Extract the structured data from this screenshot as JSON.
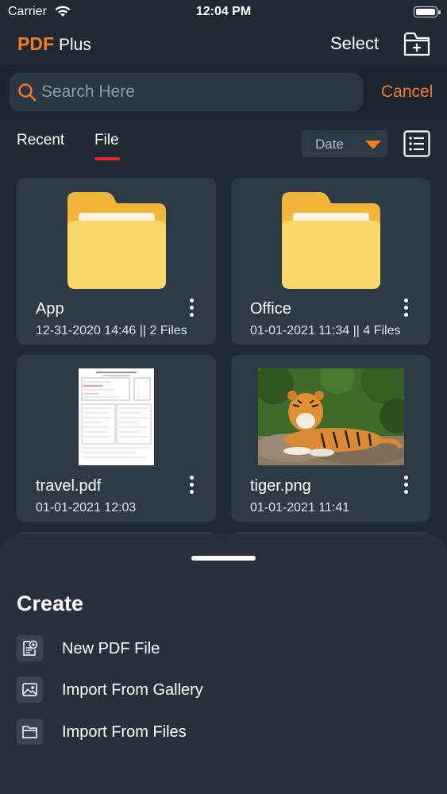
{
  "status_bar": {
    "carrier": "Carrier",
    "time": "12:04 PM"
  },
  "header": {
    "logo_pdf": "PDF",
    "logo_plus": "Plus",
    "select_label": "Select"
  },
  "search": {
    "placeholder": "Search Here",
    "value": "",
    "cancel_label": "Cancel"
  },
  "tabs": [
    {
      "label": "Recent",
      "active": false
    },
    {
      "label": "File",
      "active": true
    }
  ],
  "sort": {
    "selected": "Date"
  },
  "files": [
    {
      "name": "App",
      "meta": "12-31-2020 14:46 || 2 Files",
      "kind": "folder"
    },
    {
      "name": "Office",
      "meta": "01-01-2021 11:34 || 4 Files",
      "kind": "folder"
    },
    {
      "name": "travel.pdf",
      "meta": "01-01-2021 12:03",
      "kind": "pdf"
    },
    {
      "name": "tiger.png",
      "meta": "01-01-2021 11:41",
      "kind": "image"
    }
  ],
  "create_sheet": {
    "title": "Create",
    "items": [
      {
        "label": "New PDF File",
        "icon": "new-pdf-icon"
      },
      {
        "label": "Import From Gallery",
        "icon": "gallery-icon"
      },
      {
        "label": "Import From Files",
        "icon": "folder-icon"
      }
    ]
  },
  "colors": {
    "background": "#1f2a35",
    "card": "#2f3a47",
    "accent": "#f47b20",
    "tab_indicator": "#e3262c",
    "folder": "#fbd86a"
  }
}
